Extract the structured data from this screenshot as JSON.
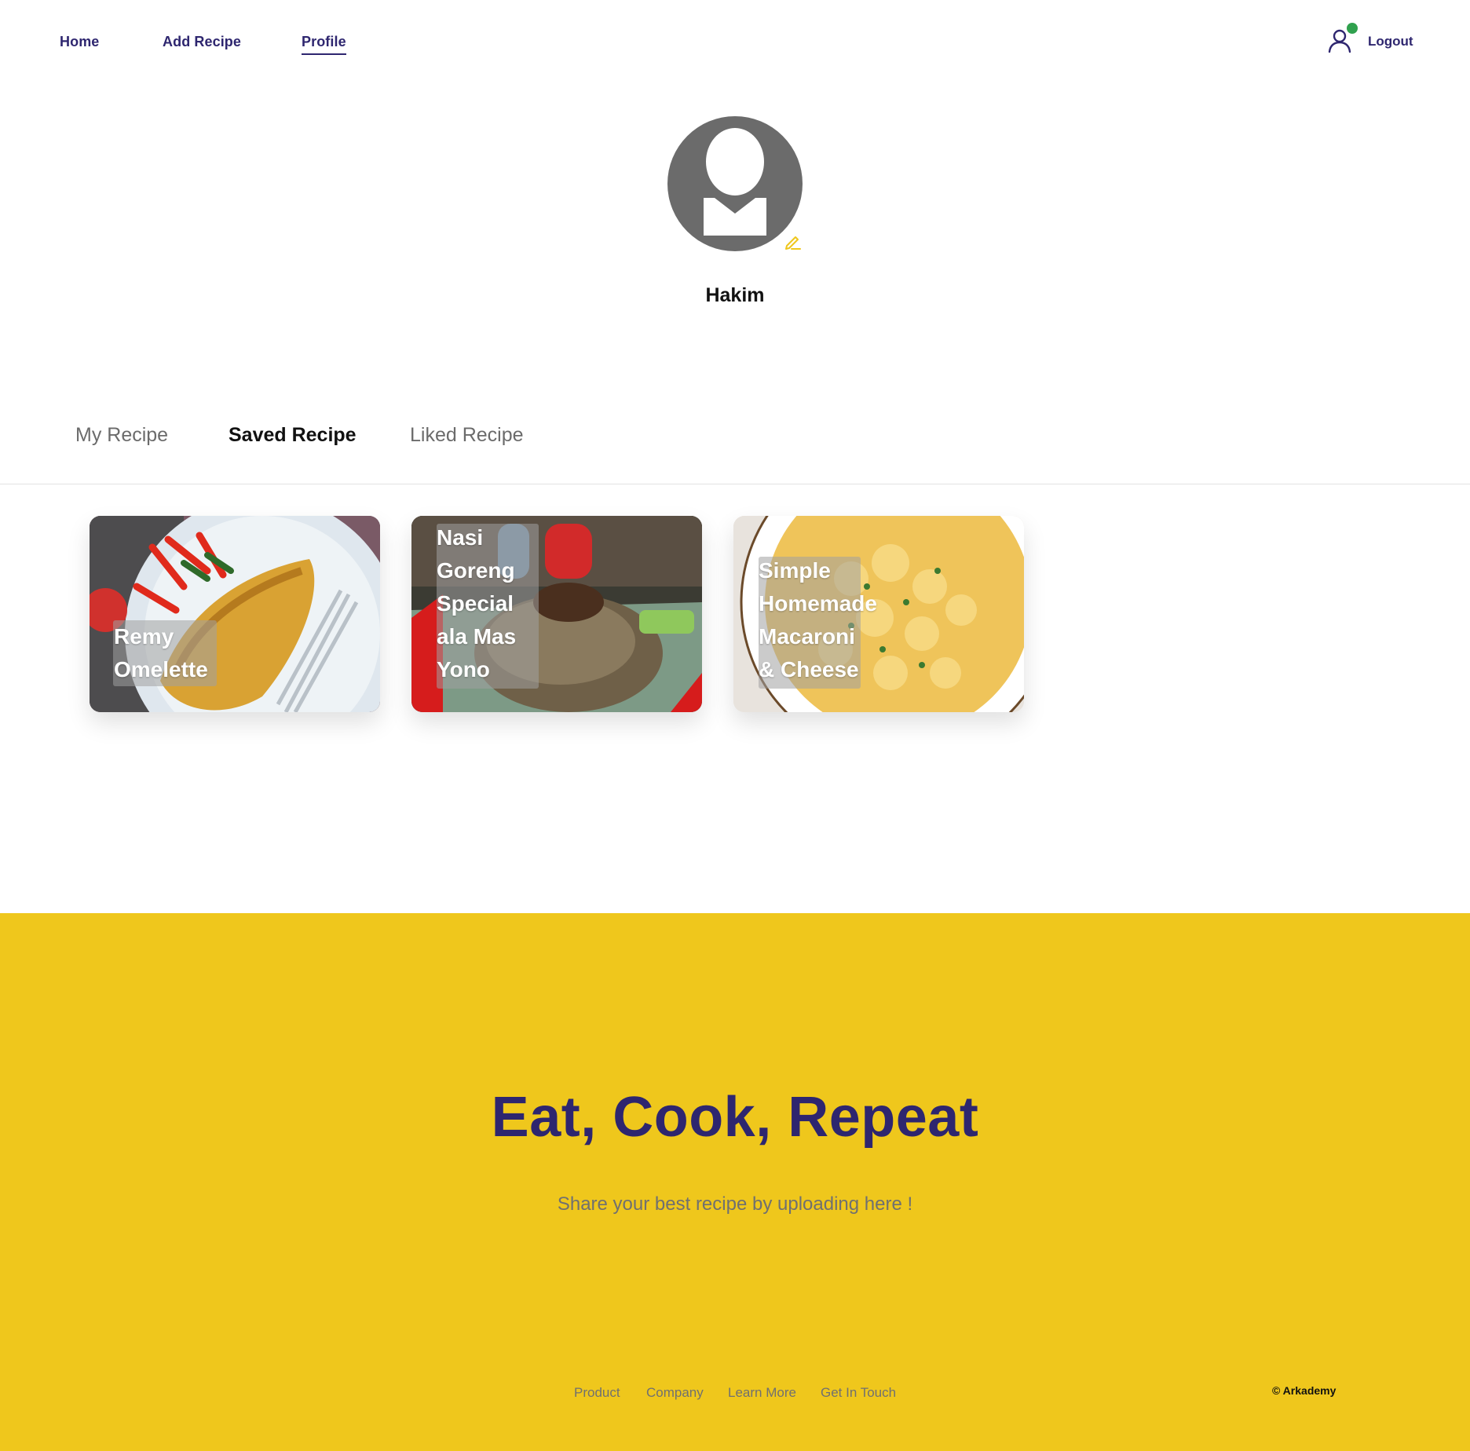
{
  "nav": {
    "home": "Home",
    "add_recipe": "Add Recipe",
    "profile": "Profile",
    "logout": "Logout",
    "active": "Profile",
    "online_color": "#30a14e"
  },
  "profile": {
    "name": "Hakim",
    "avatar_icon": "user-silhouette-icon",
    "edit_icon": "pencil-icon"
  },
  "tabs": [
    {
      "label": "My Recipe",
      "active": false
    },
    {
      "label": "Saved Recipe",
      "active": true
    },
    {
      "label": "Liked Recipe",
      "active": false
    }
  ],
  "recipes": [
    {
      "title": "Remy\nOmelette"
    },
    {
      "title": "Nasi\nGoreng\nSpecial\nala Mas\nYono"
    },
    {
      "title": "Simple\nHomemade\nMacaroni\n& Cheese"
    }
  ],
  "footer": {
    "title": "Eat, Cook, Repeat",
    "subtitle": "Share your best recipe by uploading here !",
    "links": [
      "Product",
      "Company",
      "Learn More",
      "Get In Touch"
    ],
    "copyright": "© Arkademy",
    "bg_color": "#efc71c",
    "title_color": "#2e266f"
  }
}
